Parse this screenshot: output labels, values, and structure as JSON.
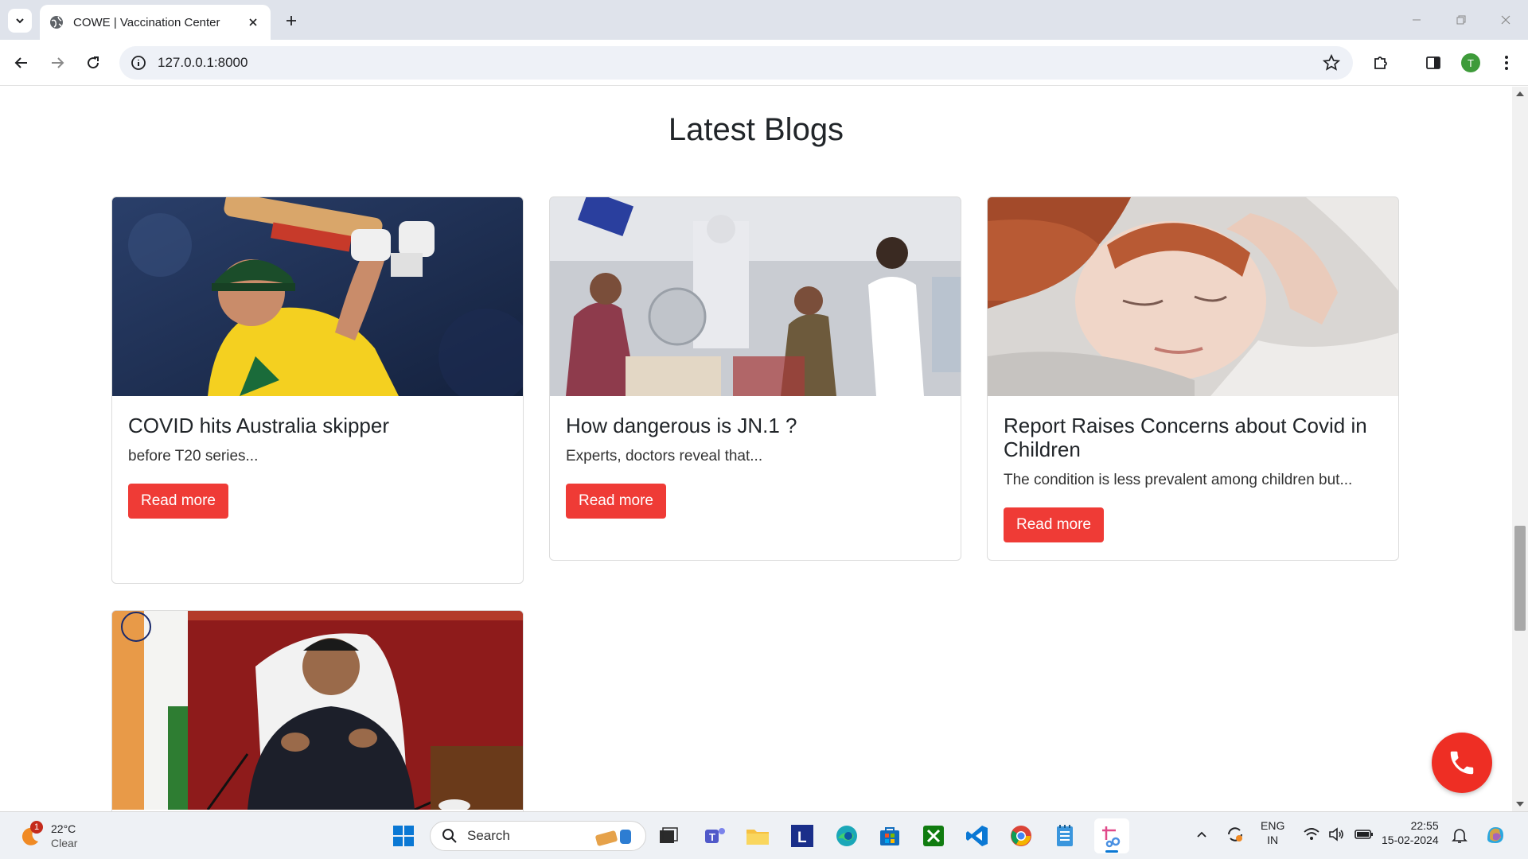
{
  "browser": {
    "tab_title": "COWE | Vaccination Center",
    "url": "127.0.0.1:8000",
    "profile_initial": "T"
  },
  "page": {
    "section_title": "Latest Blogs",
    "blogs": [
      {
        "title": "COVID hits Australia skipper",
        "excerpt": "before T20 series...",
        "button": "Read more",
        "image": "cricketer-batting-photo"
      },
      {
        "title": "How dangerous is JN.1 ?",
        "excerpt": "Experts, doctors reveal that...",
        "button": "Read more",
        "image": "hospital-ward-photo"
      },
      {
        "title": "Report Raises Concerns about Covid in Children",
        "excerpt": "The condition is less prevalent among children but...",
        "button": "Read more",
        "image": "sleeping-woman-photo"
      },
      {
        "image": "minister-press-conference-photo"
      }
    ],
    "call_button_icon": "phone-icon",
    "accent_color": "#ef3b36"
  },
  "taskbar": {
    "weather_temp": "22°C",
    "weather_condition": "Clear",
    "weather_badge": "1",
    "search_placeholder": "Search",
    "language_line1": "ENG",
    "language_line2": "IN",
    "time": "22:55",
    "date": "15-02-2024"
  }
}
